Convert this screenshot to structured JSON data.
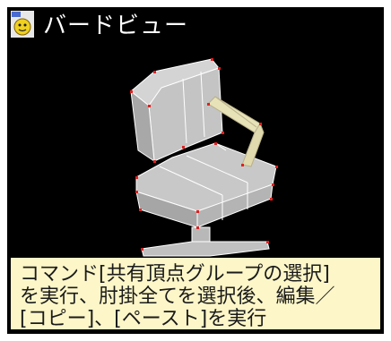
{
  "window": {
    "title": "バードビュー",
    "icon": "app-character-icon",
    "background": "#000000"
  },
  "scene": {
    "object": "office-chair-wireframe",
    "mesh_color": "#c8c8c8",
    "edge_color": "#ffffff",
    "vertex_color": "#e02020",
    "selected_part_color": "#e8e2b8"
  },
  "caption": {
    "background": "#fcf6c8",
    "lines": [
      "コマンド[共有頂点グループの選択]",
      "を実行、肘掛全てを選択後、編集／",
      "[コピー]、[ペースト]を実行"
    ]
  }
}
